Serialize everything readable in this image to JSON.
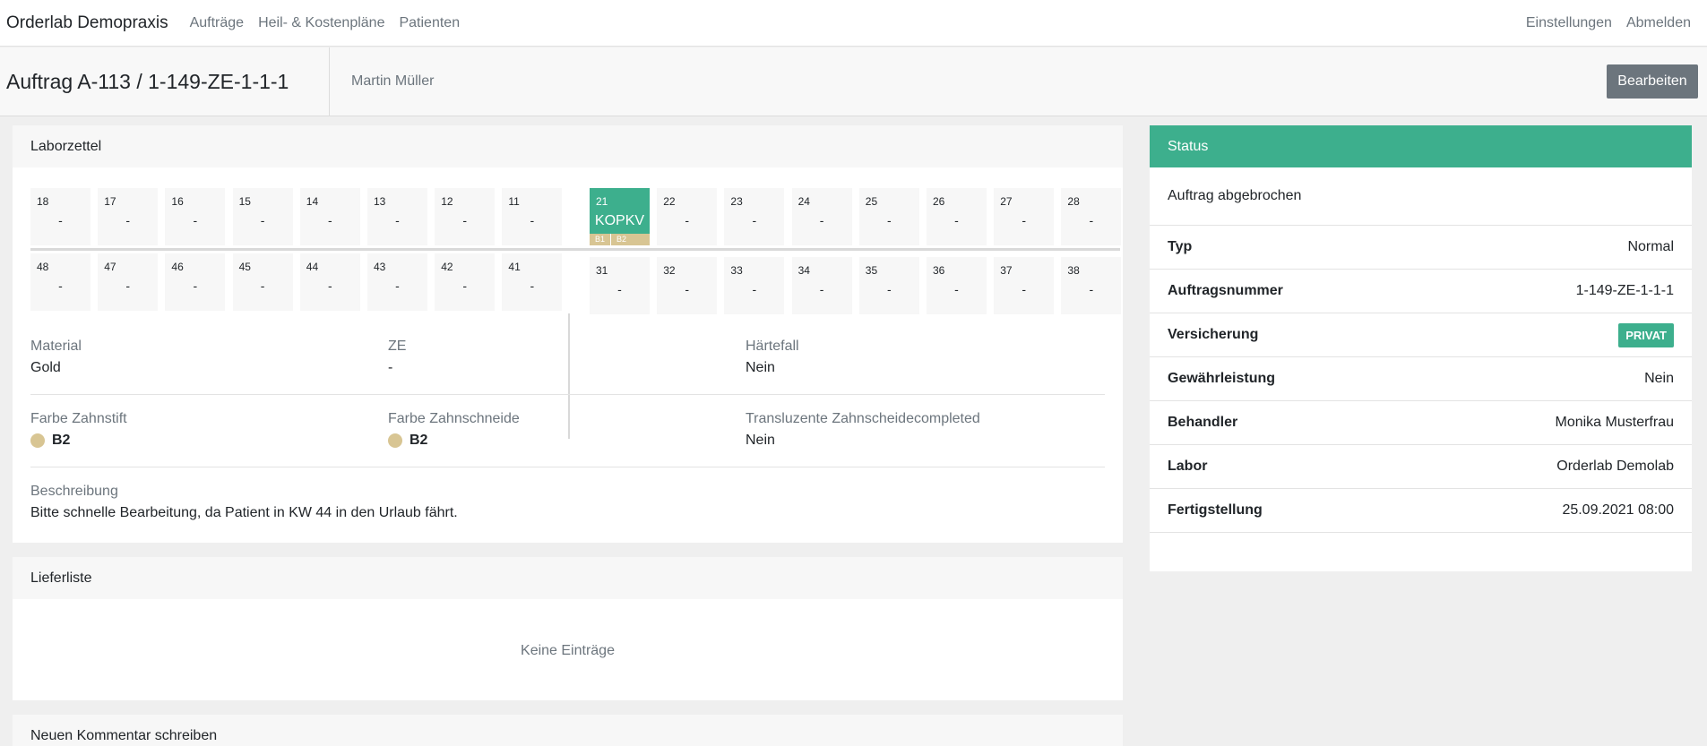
{
  "navbar": {
    "brand": "Orderlab Demopraxis",
    "links": [
      "Aufträge",
      "Heil- & Kostenpläne",
      "Patienten"
    ],
    "right": [
      "Einstellungen",
      "Abmelden"
    ]
  },
  "header": {
    "title": "Auftrag A-113 / 1-149-ZE-1-1-1",
    "patient": "Martin Müller",
    "edit_label": "Bearbeiten"
  },
  "laborzettel": {
    "title": "Laborzettel",
    "upper_left": [
      {
        "num": "18",
        "val": "-"
      },
      {
        "num": "17",
        "val": "-"
      },
      {
        "num": "16",
        "val": "-"
      },
      {
        "num": "15",
        "val": "-"
      },
      {
        "num": "14",
        "val": "-"
      },
      {
        "num": "13",
        "val": "-"
      },
      {
        "num": "12",
        "val": "-"
      },
      {
        "num": "11",
        "val": "-"
      }
    ],
    "upper_right": [
      {
        "num": "21",
        "val": "KOPKV",
        "shades": [
          "B1",
          "B2"
        ]
      },
      {
        "num": "22",
        "val": "-"
      },
      {
        "num": "23",
        "val": "-"
      },
      {
        "num": "24",
        "val": "-"
      },
      {
        "num": "25",
        "val": "-"
      },
      {
        "num": "26",
        "val": "-"
      },
      {
        "num": "27",
        "val": "-"
      },
      {
        "num": "28",
        "val": "-"
      }
    ],
    "lower_left": [
      {
        "num": "48",
        "val": "-"
      },
      {
        "num": "47",
        "val": "-"
      },
      {
        "num": "46",
        "val": "-"
      },
      {
        "num": "45",
        "val": "-"
      },
      {
        "num": "44",
        "val": "-"
      },
      {
        "num": "43",
        "val": "-"
      },
      {
        "num": "42",
        "val": "-"
      },
      {
        "num": "41",
        "val": "-"
      }
    ],
    "lower_right": [
      {
        "num": "31",
        "val": "-"
      },
      {
        "num": "32",
        "val": "-"
      },
      {
        "num": "33",
        "val": "-"
      },
      {
        "num": "34",
        "val": "-"
      },
      {
        "num": "35",
        "val": "-"
      },
      {
        "num": "36",
        "val": "-"
      },
      {
        "num": "37",
        "val": "-"
      },
      {
        "num": "38",
        "val": "-"
      }
    ],
    "fields": {
      "material": {
        "label": "Material",
        "value": "Gold"
      },
      "ze": {
        "label": "ZE",
        "value": "-"
      },
      "haertefall": {
        "label": "Härtefall",
        "value": "Nein"
      },
      "farbe_zahnstift": {
        "label": "Farbe Zahnstift",
        "value": "B2"
      },
      "farbe_zahnschneide": {
        "label": "Farbe Zahnschneide",
        "value": "B2"
      },
      "transluzente": {
        "label": "Transluzente Zahnscheidecompleted",
        "value": "Nein"
      },
      "beschreibung": {
        "label": "Beschreibung",
        "value": "Bitte schnelle Bearbeitung, da Patient in KW 44 in den Urlaub fährt."
      }
    }
  },
  "lieferliste": {
    "title": "Lieferliste",
    "empty": "Keine Einträge"
  },
  "kommentar": {
    "title": "Neuen Kommentar schreiben"
  },
  "status": {
    "title": "Status",
    "message": "Auftrag abgebrochen",
    "rows": [
      {
        "key": "Typ",
        "value": "Normal"
      },
      {
        "key": "Auftragsnummer",
        "value": "1-149-ZE-1-1-1"
      },
      {
        "key": "Versicherung",
        "value": "PRIVAT",
        "badge": true
      },
      {
        "key": "Gewährleistung",
        "value": "Nein"
      },
      {
        "key": "Behandler",
        "value": "Monika Musterfrau"
      },
      {
        "key": "Labor",
        "value": "Orderlab Demolab"
      },
      {
        "key": "Fertigstellung",
        "value": "25.09.2021 08:00"
      }
    ]
  },
  "colors": {
    "accent": "#3daf8d",
    "shade": "#d8c593",
    "muted": "#6c757d"
  }
}
